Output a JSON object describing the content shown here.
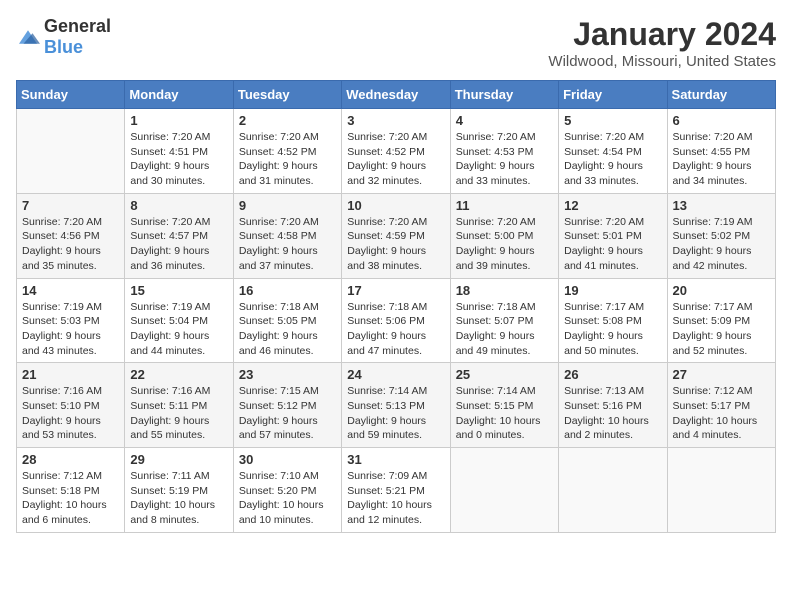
{
  "logo": {
    "text_general": "General",
    "text_blue": "Blue"
  },
  "calendar": {
    "title": "January 2024",
    "subtitle": "Wildwood, Missouri, United States",
    "headers": [
      "Sunday",
      "Monday",
      "Tuesday",
      "Wednesday",
      "Thursday",
      "Friday",
      "Saturday"
    ],
    "weeks": [
      [
        {
          "day": "",
          "sunrise": "",
          "sunset": "",
          "daylight": ""
        },
        {
          "day": "1",
          "sunrise": "Sunrise: 7:20 AM",
          "sunset": "Sunset: 4:51 PM",
          "daylight": "Daylight: 9 hours and 30 minutes."
        },
        {
          "day": "2",
          "sunrise": "Sunrise: 7:20 AM",
          "sunset": "Sunset: 4:52 PM",
          "daylight": "Daylight: 9 hours and 31 minutes."
        },
        {
          "day": "3",
          "sunrise": "Sunrise: 7:20 AM",
          "sunset": "Sunset: 4:52 PM",
          "daylight": "Daylight: 9 hours and 32 minutes."
        },
        {
          "day": "4",
          "sunrise": "Sunrise: 7:20 AM",
          "sunset": "Sunset: 4:53 PM",
          "daylight": "Daylight: 9 hours and 33 minutes."
        },
        {
          "day": "5",
          "sunrise": "Sunrise: 7:20 AM",
          "sunset": "Sunset: 4:54 PM",
          "daylight": "Daylight: 9 hours and 33 minutes."
        },
        {
          "day": "6",
          "sunrise": "Sunrise: 7:20 AM",
          "sunset": "Sunset: 4:55 PM",
          "daylight": "Daylight: 9 hours and 34 minutes."
        }
      ],
      [
        {
          "day": "7",
          "sunrise": "Sunrise: 7:20 AM",
          "sunset": "Sunset: 4:56 PM",
          "daylight": "Daylight: 9 hours and 35 minutes."
        },
        {
          "day": "8",
          "sunrise": "Sunrise: 7:20 AM",
          "sunset": "Sunset: 4:57 PM",
          "daylight": "Daylight: 9 hours and 36 minutes."
        },
        {
          "day": "9",
          "sunrise": "Sunrise: 7:20 AM",
          "sunset": "Sunset: 4:58 PM",
          "daylight": "Daylight: 9 hours and 37 minutes."
        },
        {
          "day": "10",
          "sunrise": "Sunrise: 7:20 AM",
          "sunset": "Sunset: 4:59 PM",
          "daylight": "Daylight: 9 hours and 38 minutes."
        },
        {
          "day": "11",
          "sunrise": "Sunrise: 7:20 AM",
          "sunset": "Sunset: 5:00 PM",
          "daylight": "Daylight: 9 hours and 39 minutes."
        },
        {
          "day": "12",
          "sunrise": "Sunrise: 7:20 AM",
          "sunset": "Sunset: 5:01 PM",
          "daylight": "Daylight: 9 hours and 41 minutes."
        },
        {
          "day": "13",
          "sunrise": "Sunrise: 7:19 AM",
          "sunset": "Sunset: 5:02 PM",
          "daylight": "Daylight: 9 hours and 42 minutes."
        }
      ],
      [
        {
          "day": "14",
          "sunrise": "Sunrise: 7:19 AM",
          "sunset": "Sunset: 5:03 PM",
          "daylight": "Daylight: 9 hours and 43 minutes."
        },
        {
          "day": "15",
          "sunrise": "Sunrise: 7:19 AM",
          "sunset": "Sunset: 5:04 PM",
          "daylight": "Daylight: 9 hours and 44 minutes."
        },
        {
          "day": "16",
          "sunrise": "Sunrise: 7:18 AM",
          "sunset": "Sunset: 5:05 PM",
          "daylight": "Daylight: 9 hours and 46 minutes."
        },
        {
          "day": "17",
          "sunrise": "Sunrise: 7:18 AM",
          "sunset": "Sunset: 5:06 PM",
          "daylight": "Daylight: 9 hours and 47 minutes."
        },
        {
          "day": "18",
          "sunrise": "Sunrise: 7:18 AM",
          "sunset": "Sunset: 5:07 PM",
          "daylight": "Daylight: 9 hours and 49 minutes."
        },
        {
          "day": "19",
          "sunrise": "Sunrise: 7:17 AM",
          "sunset": "Sunset: 5:08 PM",
          "daylight": "Daylight: 9 hours and 50 minutes."
        },
        {
          "day": "20",
          "sunrise": "Sunrise: 7:17 AM",
          "sunset": "Sunset: 5:09 PM",
          "daylight": "Daylight: 9 hours and 52 minutes."
        }
      ],
      [
        {
          "day": "21",
          "sunrise": "Sunrise: 7:16 AM",
          "sunset": "Sunset: 5:10 PM",
          "daylight": "Daylight: 9 hours and 53 minutes."
        },
        {
          "day": "22",
          "sunrise": "Sunrise: 7:16 AM",
          "sunset": "Sunset: 5:11 PM",
          "daylight": "Daylight: 9 hours and 55 minutes."
        },
        {
          "day": "23",
          "sunrise": "Sunrise: 7:15 AM",
          "sunset": "Sunset: 5:12 PM",
          "daylight": "Daylight: 9 hours and 57 minutes."
        },
        {
          "day": "24",
          "sunrise": "Sunrise: 7:14 AM",
          "sunset": "Sunset: 5:13 PM",
          "daylight": "Daylight: 9 hours and 59 minutes."
        },
        {
          "day": "25",
          "sunrise": "Sunrise: 7:14 AM",
          "sunset": "Sunset: 5:15 PM",
          "daylight": "Daylight: 10 hours and 0 minutes."
        },
        {
          "day": "26",
          "sunrise": "Sunrise: 7:13 AM",
          "sunset": "Sunset: 5:16 PM",
          "daylight": "Daylight: 10 hours and 2 minutes."
        },
        {
          "day": "27",
          "sunrise": "Sunrise: 7:12 AM",
          "sunset": "Sunset: 5:17 PM",
          "daylight": "Daylight: 10 hours and 4 minutes."
        }
      ],
      [
        {
          "day": "28",
          "sunrise": "Sunrise: 7:12 AM",
          "sunset": "Sunset: 5:18 PM",
          "daylight": "Daylight: 10 hours and 6 minutes."
        },
        {
          "day": "29",
          "sunrise": "Sunrise: 7:11 AM",
          "sunset": "Sunset: 5:19 PM",
          "daylight": "Daylight: 10 hours and 8 minutes."
        },
        {
          "day": "30",
          "sunrise": "Sunrise: 7:10 AM",
          "sunset": "Sunset: 5:20 PM",
          "daylight": "Daylight: 10 hours and 10 minutes."
        },
        {
          "day": "31",
          "sunrise": "Sunrise: 7:09 AM",
          "sunset": "Sunset: 5:21 PM",
          "daylight": "Daylight: 10 hours and 12 minutes."
        },
        {
          "day": "",
          "sunrise": "",
          "sunset": "",
          "daylight": ""
        },
        {
          "day": "",
          "sunrise": "",
          "sunset": "",
          "daylight": ""
        },
        {
          "day": "",
          "sunrise": "",
          "sunset": "",
          "daylight": ""
        }
      ]
    ]
  }
}
